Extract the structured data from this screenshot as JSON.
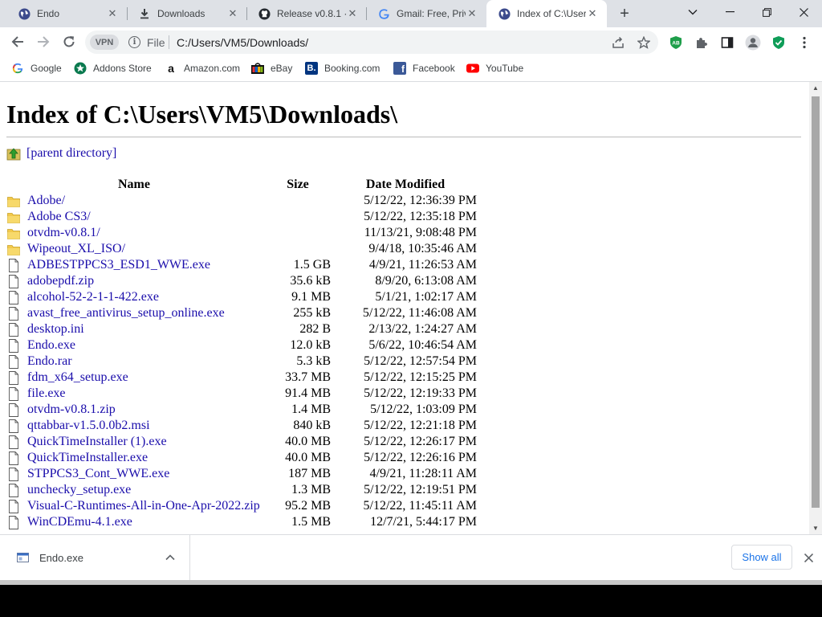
{
  "browser": {
    "tabs": [
      {
        "title": "Endo",
        "icon": "globe-icon"
      },
      {
        "title": "Downloads",
        "icon": "download-icon"
      },
      {
        "title": "Release v0.8.1 · ",
        "icon": "github-icon"
      },
      {
        "title": "Gmail: Free, Priv",
        "icon": "google-icon"
      },
      {
        "title": "Index of C:\\User",
        "icon": "globe-icon",
        "active": true
      }
    ],
    "toolbar": {
      "vpn_label": "VPN",
      "scheme_label": "File",
      "url": "C:/Users/VM5/Downloads/"
    },
    "bookmarks": [
      {
        "label": "Google",
        "icon": "google-icon"
      },
      {
        "label": "Addons Store",
        "icon": "addons-store-icon"
      },
      {
        "label": "Amazon.com",
        "icon": "amazon-icon"
      },
      {
        "label": "eBay",
        "icon": "ebay-icon"
      },
      {
        "label": "Booking.com",
        "icon": "booking-icon"
      },
      {
        "label": "Facebook",
        "icon": "facebook-icon"
      },
      {
        "label": "YouTube",
        "icon": "youtube-icon"
      }
    ],
    "extension_badge": "AB"
  },
  "page": {
    "heading": "Index of C:\\Users\\VM5\\Downloads\\",
    "parent_link": "[parent directory]",
    "columns": {
      "name": "Name",
      "size": "Size",
      "date": "Date Modified"
    },
    "entries": [
      {
        "name": "Adobe/",
        "size": "",
        "date": "5/12/22, 12:36:39 PM",
        "type": "folder"
      },
      {
        "name": "Adobe CS3/",
        "size": "",
        "date": "5/12/22, 12:35:18 PM",
        "type": "folder"
      },
      {
        "name": "otvdm-v0.8.1/",
        "size": "",
        "date": "11/13/21, 9:08:48 PM",
        "type": "folder"
      },
      {
        "name": "Wipeout_XL_ISO/",
        "size": "",
        "date": "9/4/18, 10:35:46 AM",
        "type": "folder"
      },
      {
        "name": "ADBESTPPCS3_ESD1_WWE.exe",
        "size": "1.5 GB",
        "date": "4/9/21, 11:26:53 AM",
        "type": "file"
      },
      {
        "name": "adobepdf.zip",
        "size": "35.6 kB",
        "date": "8/9/20, 6:13:08 AM",
        "type": "file"
      },
      {
        "name": "alcohol-52-2-1-1-422.exe",
        "size": "9.1 MB",
        "date": "5/1/21, 1:02:17 AM",
        "type": "file"
      },
      {
        "name": "avast_free_antivirus_setup_online.exe",
        "size": "255 kB",
        "date": "5/12/22, 11:46:08 AM",
        "type": "file"
      },
      {
        "name": "desktop.ini",
        "size": "282 B",
        "date": "2/13/22, 1:24:27 AM",
        "type": "file"
      },
      {
        "name": "Endo.exe",
        "size": "12.0 kB",
        "date": "5/6/22, 10:46:54 AM",
        "type": "file"
      },
      {
        "name": "Endo.rar",
        "size": "5.3 kB",
        "date": "5/12/22, 12:57:54 PM",
        "type": "file"
      },
      {
        "name": "fdm_x64_setup.exe",
        "size": "33.7 MB",
        "date": "5/12/22, 12:15:25 PM",
        "type": "file"
      },
      {
        "name": "file.exe",
        "size": "91.4 MB",
        "date": "5/12/22, 12:19:33 PM",
        "type": "file"
      },
      {
        "name": "otvdm-v0.8.1.zip",
        "size": "1.4 MB",
        "date": "5/12/22, 1:03:09 PM",
        "type": "file"
      },
      {
        "name": "qttabbar-v1.5.0.0b2.msi",
        "size": "840 kB",
        "date": "5/12/22, 12:21:18 PM",
        "type": "file"
      },
      {
        "name": "QuickTimeInstaller (1).exe",
        "size": "40.0 MB",
        "date": "5/12/22, 12:26:17 PM",
        "type": "file"
      },
      {
        "name": "QuickTimeInstaller.exe",
        "size": "40.0 MB",
        "date": "5/12/22, 12:26:16 PM",
        "type": "file"
      },
      {
        "name": "STPPCS3_Cont_WWE.exe",
        "size": "187 MB",
        "date": "4/9/21, 11:28:11 AM",
        "type": "file"
      },
      {
        "name": "unchecky_setup.exe",
        "size": "1.3 MB",
        "date": "5/12/22, 12:19:51 PM",
        "type": "file"
      },
      {
        "name": "Visual-C-Runtimes-All-in-One-Apr-2022.zip",
        "size": "95.2 MB",
        "date": "5/12/22, 11:45:11 AM",
        "type": "file"
      },
      {
        "name": "WinCDEmu-4.1.exe",
        "size": "1.5 MB",
        "date": "12/7/21, 5:44:17 PM",
        "type": "file"
      }
    ]
  },
  "download_shelf": {
    "item_name": "Endo.exe",
    "show_all_label": "Show all"
  },
  "colors": {
    "link": "#1a0dab",
    "folder": "#f2c94c",
    "tabstrip": "#dee1e6",
    "omnibox": "#f1f3f4",
    "accent_blue": "#1a73e8"
  }
}
